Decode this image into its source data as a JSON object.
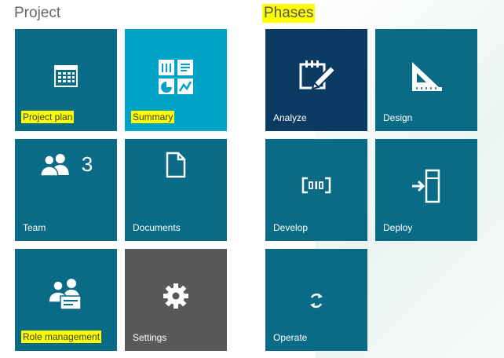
{
  "sections": {
    "project_title": "Project",
    "phases_title": "Phases"
  },
  "project_tiles": {
    "project_plan": {
      "label": "Project plan",
      "icon": "calendar-icon",
      "highlighted": true
    },
    "summary": {
      "label": "Summary",
      "icon": "summary-dashboard-icon",
      "highlighted": true
    },
    "team": {
      "label": "Team",
      "count": "3",
      "icon": "people-icon"
    },
    "documents": {
      "label": "Documents",
      "icon": "document-icon"
    },
    "role_management": {
      "label": "Role management",
      "icon": "role-management-icon",
      "highlighted": true
    },
    "settings": {
      "label": "Settings",
      "icon": "gear-icon"
    }
  },
  "phase_tiles": {
    "analyze": {
      "label": "Analyze",
      "icon": "clipboard-pencil-icon"
    },
    "design": {
      "label": "Design",
      "icon": "set-square-icon"
    },
    "develop": {
      "label": "Develop",
      "icon": "code-binary-icon"
    },
    "deploy": {
      "label": "Deploy",
      "icon": "server-arrow-icon"
    },
    "operate": {
      "label": "Operate",
      "icon": "refresh-cycle-icon"
    }
  },
  "colors": {
    "tile_teal": "#0a6b86",
    "tile_cyan": "#00a3c6",
    "tile_navy": "#0b3a63",
    "tile_gray": "#595959",
    "highlight": "#ffff00"
  }
}
